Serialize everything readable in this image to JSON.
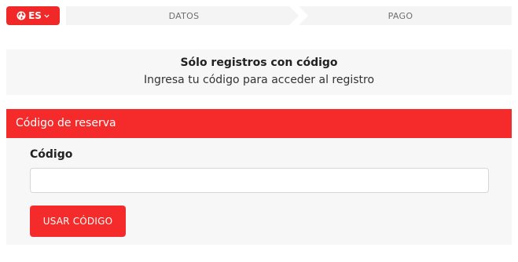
{
  "language": {
    "code": "ES",
    "globe_icon": "globe-icon",
    "chevron_icon": "chevron-down-icon"
  },
  "steps": [
    {
      "label": "DATOS"
    },
    {
      "label": "PAGO"
    }
  ],
  "notice": {
    "title": "Sólo registros con código",
    "subtitle": "Ingresa tu código para acceder al registro"
  },
  "reservation": {
    "header": "Código de reserva",
    "field_label": "Código",
    "input_value": "",
    "input_placeholder": "",
    "submit_label": "USAR CÓDIGO"
  },
  "colors": {
    "accent": "#f52b2b",
    "panel_bg": "#f7f7f7",
    "step_bg": "#f4f4f4"
  }
}
